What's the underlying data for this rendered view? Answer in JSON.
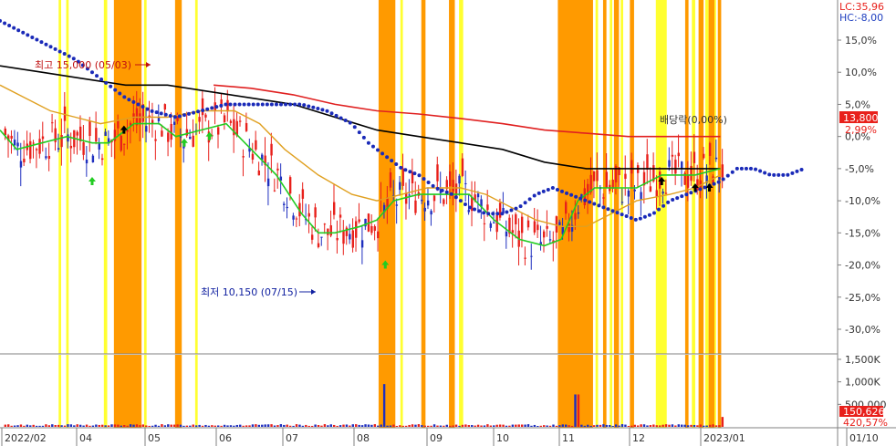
{
  "chart_data": {
    "type": "candlestick",
    "lc_label": "LC:35,96",
    "hc_label": "HC:-8,00",
    "high_annotation": "최고 15,000 (05/03)",
    "low_annotation": "최저 10,150 (07/15)",
    "dividend_annotation": "배당락(0,00%)",
    "price_tag": "13,800",
    "change_tag": "2,99%",
    "volume_tag": "150,626",
    "volume_ratio_tag": "420,57%",
    "y_ticks": [
      "15,0%",
      "10,0%",
      "5,0%",
      "0,0%",
      "-5,0%",
      "-10,0%",
      "-15,0%",
      "-20,0%",
      "-25,0%",
      "-30,0%"
    ],
    "y_range": [
      -35,
      20
    ],
    "volume_ticks": [
      "1,500K",
      "1,000K",
      "500,000"
    ],
    "x_labels": [
      "2022/02",
      "04",
      "05",
      "06",
      "07",
      "08",
      "09",
      "10",
      "11",
      "12",
      "2023/01",
      "01/10"
    ],
    "high_point": {
      "price": 15000,
      "date": "05/03"
    },
    "low_point": {
      "price": 10150,
      "date": "07/15"
    },
    "last_price": 13800,
    "last_change_pct": 2.99,
    "colors": {
      "up": "#e8201b",
      "down": "#1f2fbf",
      "ma20": "#22cc22",
      "ma60": "#e0a020",
      "ma120": "#000000",
      "ma240": "#e02020",
      "envelope": "#1a2ab8",
      "yellow_band": "#ffff30",
      "orange_band": "#ff9a00",
      "tag_bg": "#e8201b"
    },
    "yellow_bands": [
      [
        0.07,
        0.073
      ],
      [
        0.079,
        0.082
      ],
      [
        0.124,
        0.128
      ],
      [
        0.172,
        0.175
      ],
      [
        0.233,
        0.236
      ],
      [
        0.478,
        0.481
      ],
      [
        0.548,
        0.553
      ],
      [
        0.691,
        0.694
      ],
      [
        0.711,
        0.714
      ],
      [
        0.728,
        0.731
      ],
      [
        0.741,
        0.744
      ],
      [
        0.783,
        0.796
      ],
      [
        0.826,
        0.83
      ],
      [
        0.842,
        0.846
      ],
      [
        0.851,
        0.855
      ]
    ],
    "orange_bands": [
      [
        0.136,
        0.169
      ],
      [
        0.209,
        0.217
      ],
      [
        0.452,
        0.472
      ],
      [
        0.503,
        0.508
      ],
      [
        0.536,
        0.543
      ],
      [
        0.666,
        0.708
      ],
      [
        0.72,
        0.724
      ],
      [
        0.733,
        0.739
      ],
      [
        0.752,
        0.757
      ],
      [
        0.818,
        0.822
      ],
      [
        0.834,
        0.84
      ],
      [
        0.846,
        0.853
      ],
      [
        0.857,
        0.861
      ]
    ],
    "ma20": [
      [
        0,
        1
      ],
      [
        0.02,
        -2
      ],
      [
        0.05,
        -1
      ],
      [
        0.08,
        0
      ],
      [
        0.11,
        -1
      ],
      [
        0.13,
        -1
      ],
      [
        0.16,
        2
      ],
      [
        0.19,
        2
      ],
      [
        0.21,
        0
      ],
      [
        0.24,
        1
      ],
      [
        0.27,
        2
      ],
      [
        0.3,
        -2
      ],
      [
        0.33,
        -6
      ],
      [
        0.36,
        -12
      ],
      [
        0.38,
        -15
      ],
      [
        0.4,
        -15
      ],
      [
        0.43,
        -14
      ],
      [
        0.45,
        -13
      ],
      [
        0.47,
        -10
      ],
      [
        0.5,
        -9
      ],
      [
        0.53,
        -9
      ],
      [
        0.56,
        -9
      ],
      [
        0.59,
        -13
      ],
      [
        0.62,
        -16
      ],
      [
        0.65,
        -17
      ],
      [
        0.67,
        -16
      ],
      [
        0.69,
        -10
      ],
      [
        0.71,
        -8
      ],
      [
        0.73,
        -8
      ],
      [
        0.76,
        -8
      ],
      [
        0.79,
        -6
      ],
      [
        0.83,
        -6
      ],
      [
        0.86,
        -5
      ]
    ],
    "ma60": [
      [
        0,
        8
      ],
      [
        0.03,
        6
      ],
      [
        0.06,
        4
      ],
      [
        0.09,
        3
      ],
      [
        0.12,
        2
      ],
      [
        0.16,
        3
      ],
      [
        0.2,
        3
      ],
      [
        0.24,
        4
      ],
      [
        0.28,
        4
      ],
      [
        0.31,
        2
      ],
      [
        0.34,
        -2
      ],
      [
        0.38,
        -6
      ],
      [
        0.42,
        -9
      ],
      [
        0.45,
        -10
      ],
      [
        0.48,
        -9
      ],
      [
        0.51,
        -8
      ],
      [
        0.55,
        -8
      ],
      [
        0.58,
        -9
      ],
      [
        0.61,
        -11
      ],
      [
        0.64,
        -13
      ],
      [
        0.67,
        -14
      ],
      [
        0.7,
        -14
      ],
      [
        0.73,
        -12
      ],
      [
        0.76,
        -10
      ],
      [
        0.8,
        -9
      ],
      [
        0.83,
        -8
      ],
      [
        0.86,
        -6
      ]
    ],
    "ma120": [
      [
        0,
        11
      ],
      [
        0.05,
        10
      ],
      [
        0.1,
        9
      ],
      [
        0.15,
        8
      ],
      [
        0.2,
        8
      ],
      [
        0.25,
        7
      ],
      [
        0.3,
        6
      ],
      [
        0.35,
        5
      ],
      [
        0.4,
        3
      ],
      [
        0.45,
        1
      ],
      [
        0.5,
        0
      ],
      [
        0.55,
        -1
      ],
      [
        0.6,
        -2
      ],
      [
        0.65,
        -4
      ],
      [
        0.7,
        -5
      ],
      [
        0.75,
        -5
      ],
      [
        0.8,
        -5
      ],
      [
        0.86,
        -5
      ]
    ],
    "ma240": [
      [
        0.255,
        8
      ],
      [
        0.3,
        7.5
      ],
      [
        0.35,
        6.5
      ],
      [
        0.4,
        5
      ],
      [
        0.45,
        4
      ],
      [
        0.5,
        3.5
      ],
      [
        0.55,
        2.8
      ],
      [
        0.6,
        2
      ],
      [
        0.65,
        1
      ],
      [
        0.7,
        0.5
      ],
      [
        0.75,
        0
      ],
      [
        0.8,
        0
      ],
      [
        0.86,
        0
      ]
    ],
    "envelope": [
      [
        0,
        18
      ],
      [
        0.03,
        16
      ],
      [
        0.06,
        14
      ],
      [
        0.09,
        12
      ],
      [
        0.12,
        9
      ],
      [
        0.15,
        6
      ],
      [
        0.18,
        4
      ],
      [
        0.21,
        3
      ],
      [
        0.24,
        4
      ],
      [
        0.27,
        5
      ],
      [
        0.3,
        5
      ],
      [
        0.33,
        5
      ],
      [
        0.36,
        5
      ],
      [
        0.39,
        4
      ],
      [
        0.42,
        2
      ],
      [
        0.44,
        -1
      ],
      [
        0.46,
        -3
      ],
      [
        0.48,
        -5
      ],
      [
        0.5,
        -6
      ],
      [
        0.52,
        -8
      ],
      [
        0.54,
        -9
      ],
      [
        0.56,
        -11
      ],
      [
        0.58,
        -12
      ],
      [
        0.6,
        -12
      ],
      [
        0.62,
        -11
      ],
      [
        0.64,
        -9
      ],
      [
        0.66,
        -8
      ],
      [
        0.68,
        -9
      ],
      [
        0.7,
        -10
      ],
      [
        0.72,
        -11
      ],
      [
        0.74,
        -12
      ],
      [
        0.76,
        -13
      ],
      [
        0.78,
        -12
      ],
      [
        0.8,
        -10
      ],
      [
        0.82,
        -9
      ],
      [
        0.84,
        -8
      ],
      [
        0.86,
        -7
      ],
      [
        0.88,
        -5
      ],
      [
        0.9,
        -5
      ],
      [
        0.92,
        -6
      ],
      [
        0.94,
        -6
      ],
      [
        0.96,
        -5
      ]
    ],
    "ma20_arrows": [
      [
        0.11,
        -7
      ],
      [
        0.22,
        -1
      ],
      [
        0.25,
        0
      ],
      [
        0.46,
        -20
      ]
    ],
    "black_arrows": [
      [
        0.148,
        1
      ],
      [
        0.79,
        -7
      ],
      [
        0.83,
        -8
      ],
      [
        0.847,
        -8
      ]
    ]
  }
}
